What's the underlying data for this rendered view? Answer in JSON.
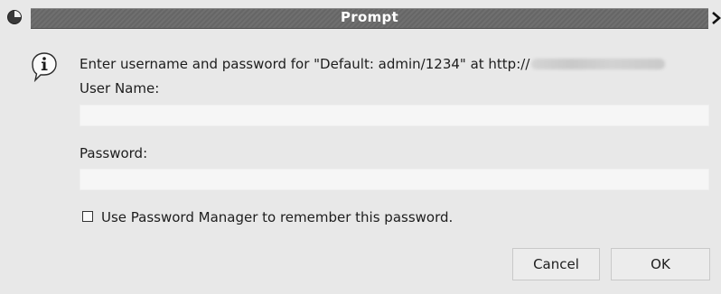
{
  "window": {
    "title": "Prompt",
    "menu_icon": "window-menu-icon",
    "close_icon": "close-chevron-icon"
  },
  "dialog": {
    "icon": "info-icon",
    "message": "Enter username and password for \"Default: admin/1234\" at http://",
    "username_label": "User Name:",
    "username_value": "",
    "password_label": "Password:",
    "password_value": "",
    "remember_checked": false,
    "remember_label": "Use Password Manager to remember this password."
  },
  "buttons": {
    "cancel": "Cancel",
    "ok": "OK"
  },
  "colors": {
    "titlebar": "#6b6b6b",
    "background": "#e8e8e8",
    "field": "#f6f6f6"
  }
}
